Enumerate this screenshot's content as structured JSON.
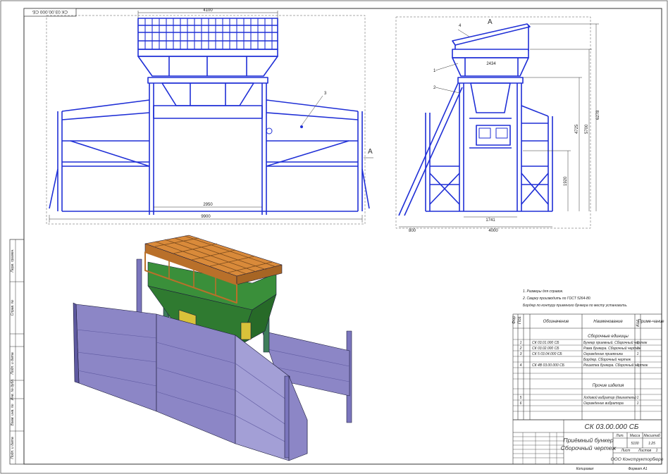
{
  "stamp": "СК 03.00.000 СБ",
  "front_view": {
    "dim_top": "4100",
    "dim_inner": "2950",
    "dim_total": "9900",
    "view_label": "А",
    "callout": "3"
  },
  "side_view": {
    "view_label": "А",
    "dim_hopper": "2434",
    "dim_h1": "6278",
    "dim_h2": "5700",
    "dim_h3": "4725",
    "dim_h4": "1920",
    "dim_left": "800",
    "dim_base_inner": "1741",
    "dim_base": "4000",
    "callouts": [
      "4",
      "1",
      "2"
    ]
  },
  "notes": [
    "1. Размеры для справок.",
    "2. Сварку производить по ГОСТ 5264-80.",
    "Бордюр по контуру приемного бункера по месту установить."
  ],
  "spec": {
    "headers": [
      "Фор",
      "Поз.",
      "Обозначение",
      "Наименование",
      "Кол.",
      "Приме-чание"
    ],
    "section1": "Сборочные единицы",
    "section2": "Прочие изделия",
    "rows": [
      {
        "pos": "1",
        "code": "СК 03.01.000 СБ",
        "name": "Бункер приемный. Сборочный чертеж",
        "qty": "1"
      },
      {
        "pos": "2",
        "code": "СК 03.02.000 СБ",
        "name": "Рама бункера. Сборочный чертеж",
        "qty": "1"
      },
      {
        "pos": "3",
        "code": "СК 5 03.04.000 СБ",
        "name": "Ограждение приемника",
        "qty": "1"
      },
      {
        "pos": "",
        "code": "",
        "name": "Бордюр. Сборочный чертеж",
        "qty": ""
      },
      {
        "pos": "4",
        "code": "СК 4В 03.00.000 СБ",
        "name": "Решетка бункера. Сборочный чертеж",
        "qty": "1"
      },
      {
        "pos": "5",
        "code": "",
        "name": "Ходовой вибратор (двигатель)",
        "qty": "1"
      },
      {
        "pos": "6",
        "code": "",
        "name": "Ограждение вибратора",
        "qty": "1"
      }
    ]
  },
  "title_block": {
    "code": "СК 03.00.000 СБ",
    "name_line1": "Приёмный бункер",
    "name_line2": "Сборочный чертеж",
    "lit_header": "Лит.",
    "mass_header": "Масса",
    "scale_header": "Масштаб",
    "mass_value": "5100",
    "scale_value": "1:25",
    "sheet_label": "Лист",
    "sheets_label": "Листов",
    "sheets_value": "1",
    "org": "ООО Конструкторбюро",
    "copied": "Копировал",
    "format": "Формат   А1"
  },
  "margin_labels": [
    "Перв. примен.",
    "Справ. №",
    "Подп. и дата",
    "Инв. № дубл.",
    "Взам. инв. №",
    "Подп. и дата",
    "Инв. № подл."
  ],
  "colors": {
    "line": "#1f2fd6",
    "grate": "#d98a3a",
    "hopper": "#3a8f3a",
    "wall": "#8c86c6",
    "frame": "#3e7e5a"
  }
}
